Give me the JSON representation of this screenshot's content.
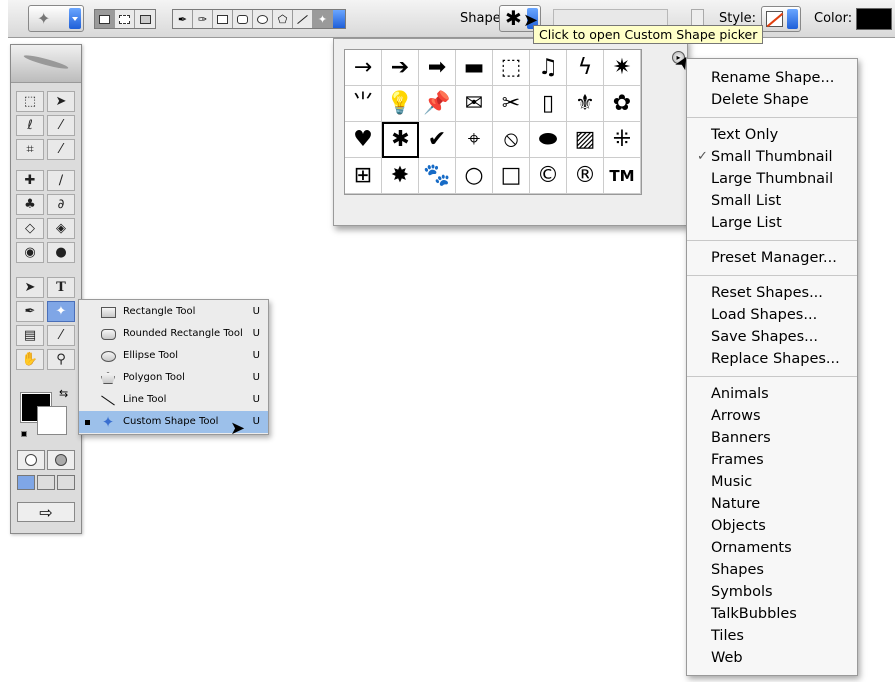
{
  "options_bar": {
    "shape_label": "Shape:",
    "tooltip": "Click to open Custom Shape picker",
    "style_label": "Style:",
    "color_label": "Color:",
    "color_value": "#000000"
  },
  "tools": {
    "icons": [
      "marquee-icon",
      "move-icon",
      "lasso-icon",
      "magic-wand-icon",
      "crop-icon",
      "slice-icon",
      "healing-brush-icon",
      "brush-icon",
      "clone-stamp-icon",
      "history-brush-icon",
      "eraser-icon",
      "paint-bucket-icon",
      "blur-icon",
      "dodge-icon",
      "path-selection-icon",
      "type-icon",
      "pen-icon",
      "custom-shape-icon",
      "notes-icon",
      "eyedropper-icon",
      "hand-icon",
      "zoom-icon"
    ],
    "type_glyph": "T"
  },
  "flyout": {
    "items": [
      {
        "label": "Rectangle Tool",
        "key": "U",
        "icon": "rectangle-icon"
      },
      {
        "label": "Rounded Rectangle Tool",
        "key": "U",
        "icon": "rounded-rectangle-icon"
      },
      {
        "label": "Ellipse Tool",
        "key": "U",
        "icon": "ellipse-icon"
      },
      {
        "label": "Polygon Tool",
        "key": "U",
        "icon": "polygon-icon"
      },
      {
        "label": "Line Tool",
        "key": "U",
        "icon": "line-icon"
      },
      {
        "label": "Custom Shape Tool",
        "key": "U",
        "icon": "custom-shape-icon",
        "active": true
      }
    ]
  },
  "picker": {
    "shapes": [
      "arrow-thin",
      "arrow-medium",
      "arrow-bold",
      "banner",
      "frame",
      "music-notes",
      "lightning",
      "starburst",
      "grass",
      "lightbulb",
      "pushpin",
      "envelope",
      "scissors",
      "blank-page",
      "fleur-de-lis",
      "puzzle",
      "heart",
      "splat",
      "checkmark",
      "target",
      "no-sign",
      "talk-bubble",
      "hatch-pattern",
      "checkerboard",
      "grid",
      "burst",
      "paw-print",
      "circle-frame",
      "square-frame",
      "copyright",
      "registered",
      "trademark"
    ],
    "glyphs": [
      "→",
      "➔",
      "➡",
      "▬",
      "⬚",
      "♫",
      "ϟ",
      "✷",
      "⺌",
      "💡",
      "📌",
      "✉",
      "✂",
      "▯",
      "⚜",
      "✿",
      "♥",
      "✱",
      "✔",
      "⌖",
      "⦸",
      "⬬",
      "▨",
      "⁜",
      "⊞",
      "✸",
      "🐾",
      "○",
      "□",
      "©",
      "®",
      "TM"
    ],
    "selected_index": 17
  },
  "menu": {
    "group1": [
      "Rename Shape...",
      "Delete Shape"
    ],
    "group2": [
      "Text Only",
      "Small Thumbnail",
      "Large Thumbnail",
      "Small List",
      "Large List"
    ],
    "checked": "Small Thumbnail",
    "group3": [
      "Preset Manager..."
    ],
    "group4": [
      "Reset Shapes...",
      "Load Shapes...",
      "Save Shapes...",
      "Replace Shapes..."
    ],
    "group5": [
      "Animals",
      "Arrows",
      "Banners",
      "Frames",
      "Music",
      "Nature",
      "Objects",
      "Ornaments",
      "Shapes",
      "Symbols",
      "TalkBubbles",
      "Tiles",
      "Web"
    ]
  }
}
